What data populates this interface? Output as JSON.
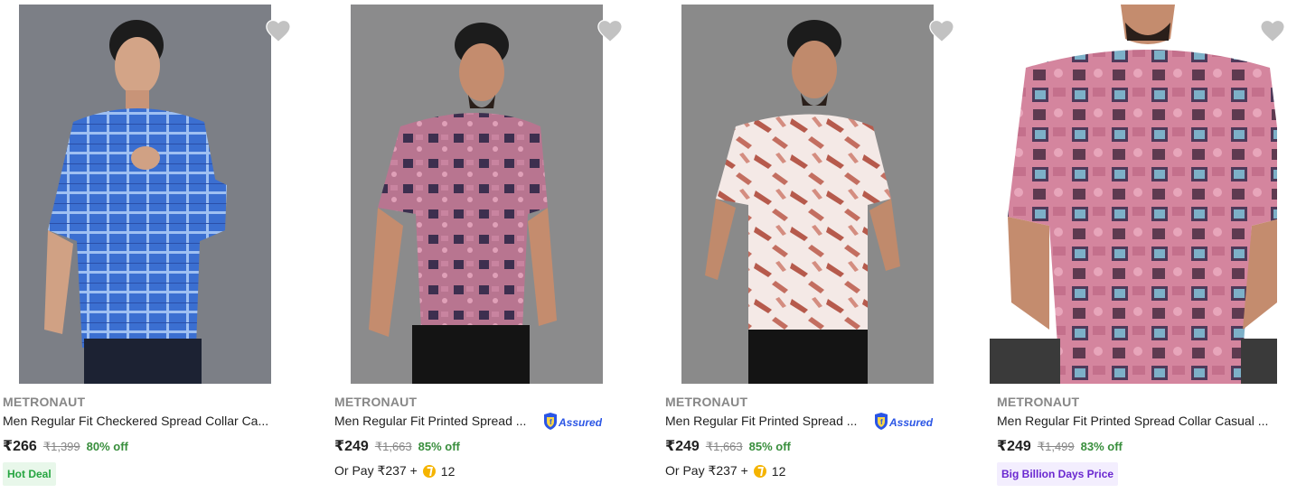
{
  "colors": {
    "brand_gray": "#878787",
    "discount_green": "#388e3c",
    "hot_deal_bg": "#e8f7ea",
    "hot_deal_text": "#26a541",
    "bbd_bg": "#f3eefe",
    "bbd_text": "#6a28d0",
    "wishlist_heart": "#c2c2c2",
    "coin": "#f5b400",
    "assured_blue": "#2a55e5"
  },
  "products": [
    {
      "brand": "METRONAUT",
      "title": "Men Regular Fit Checkered Spread Collar Ca...",
      "price": "₹266",
      "mrp": "₹1,399",
      "discount": "80% off",
      "badge": "Hot Deal",
      "image_icon": "shirt-model-image",
      "assured": false
    },
    {
      "brand": "METRONAUT",
      "title": "Men Regular Fit Printed Spread ...",
      "price": "₹249",
      "mrp": "₹1,663",
      "discount": "85% off",
      "assured": true,
      "assured_label": "Assured",
      "pay_label": "Or Pay ₹237 +",
      "coins": "12"
    },
    {
      "brand": "METRONAUT",
      "title": "Men Regular Fit Printed Spread ...",
      "price": "₹249",
      "mrp": "₹1,663",
      "discount": "85% off",
      "assured": true,
      "assured_label": "Assured",
      "pay_label": "Or Pay ₹237 +",
      "coins": "12"
    },
    {
      "brand": "METRONAUT",
      "title": "Men Regular Fit Printed Spread Collar Casual ...",
      "price": "₹249",
      "mrp": "₹1,499",
      "discount": "83% off",
      "badge": "Big Billion Days Price",
      "assured": false
    }
  ]
}
